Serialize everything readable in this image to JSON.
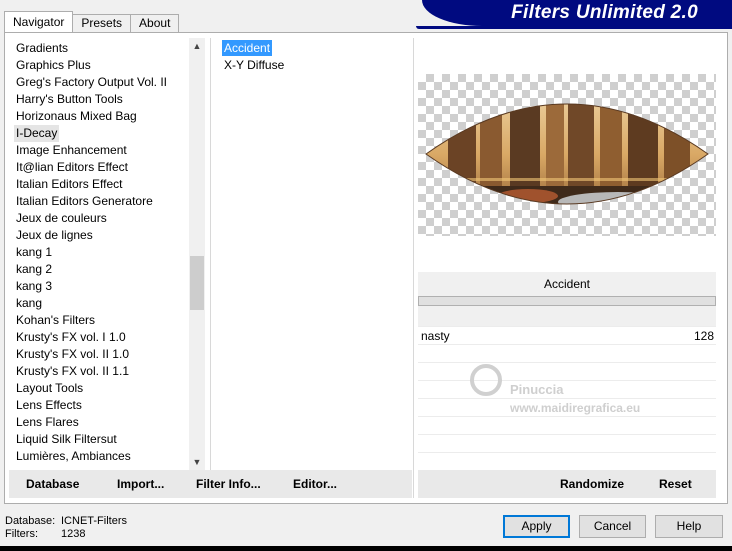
{
  "tabs": [
    "Navigator",
    "Presets",
    "About"
  ],
  "brand": "Filters Unlimited 2.0",
  "categories": [
    "Gradients",
    "Graphics Plus",
    "Greg's Factory Output Vol. II",
    "Harry's Button Tools",
    "Horizonaus Mixed Bag",
    "I-Decay",
    "Image Enhancement",
    "It@lian Editors Effect",
    "Italian Editors Effect",
    "Italian Editors Generatore",
    "Jeux de couleurs",
    "Jeux de lignes",
    "kang 1",
    "kang 2",
    "kang 3",
    "kang",
    "Kohan's Filters",
    "Krusty's FX vol. I 1.0",
    "Krusty's FX vol. II 1.0",
    "Krusty's FX vol. II 1.1",
    "Layout Tools",
    "Lens Effects",
    "Lens Flares",
    "Liquid Silk Filtersut",
    "Lumières, Ambiances"
  ],
  "selected_category": "I-Decay",
  "filters": [
    "Accident",
    "X-Y Diffuse"
  ],
  "selected_filter": "Accident",
  "param_panel": {
    "title": "Accident",
    "param_label": "nasty",
    "param_value": "128"
  },
  "watermark": {
    "name": "Pinuccia",
    "site": "www.maidiregrafica.eu"
  },
  "left_toolbar": {
    "database": "Database",
    "import": "Import...",
    "filter_info": "Filter Info...",
    "editor": "Editor..."
  },
  "right_toolbar": {
    "randomize": "Randomize",
    "reset": "Reset"
  },
  "status": {
    "database_label": "Database:",
    "database_value": "ICNET-Filters",
    "filters_label": "Filters:",
    "filters_value": "1238"
  },
  "buttons": {
    "apply": "Apply",
    "cancel": "Cancel",
    "help": "Help"
  },
  "colors": {
    "banner": "#000a80",
    "selection": "#3399ff",
    "default_button_border": "#0078d7"
  }
}
